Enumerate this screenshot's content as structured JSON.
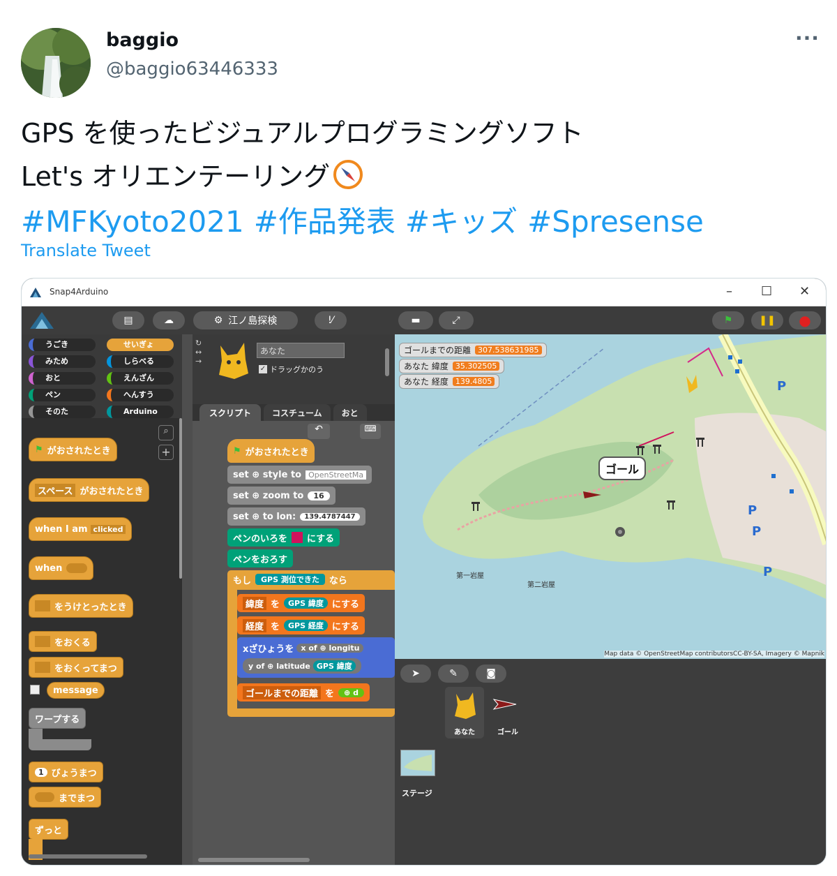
{
  "tweet": {
    "display_name": "baggio",
    "handle": "@baggio63446333",
    "more": "···",
    "line1": "GPS を使ったビジュアルプログラミングソフト",
    "line2": "Let's オリエンテーリング",
    "hashtags": [
      "#MFKyoto2021",
      "#作品発表",
      "#キッズ",
      "#Spresense"
    ],
    "translate": "Translate Tweet"
  },
  "app": {
    "window_title": "Snap4Arduino",
    "project_name": "江ノ島探検",
    "categories": [
      "うごき",
      "せいぎょ",
      "みため",
      "しらべる",
      "おと",
      "えんざん",
      "ペン",
      "へんすう",
      "そのた",
      "Arduino"
    ],
    "palette_blocks": [
      "がおされたとき",
      "スペース",
      "がおされたとき",
      "when I am",
      "clicked",
      "when",
      "をうけとったとき",
      "をおくる",
      "をおくってまつ",
      "message",
      "ワープする",
      "1",
      "びょうまつ",
      "までまつ",
      "ずっと"
    ],
    "sprite_name": "あなた",
    "draggable_label": "ドラッグかのう",
    "tabs": [
      "スクリプト",
      "コスチューム",
      "おと"
    ],
    "script_blocks": {
      "hat": "がおされたとき",
      "style": "set ⊕ style to",
      "style_val": "OpenStreetMa",
      "zoom": "set ⊕ zoom to",
      "zoom_val": "16",
      "lon": "set ⊕ to lon:",
      "lon_val": "139.4787447",
      "pen_color": "ペンのいろを",
      "pen_color_end": "にする",
      "pen_down": "ペンをおろす",
      "if": "もし",
      "if_cond": "GPS 測位できた",
      "if_end": "なら",
      "set1_var": "緯度",
      "set1_mid": "を",
      "set1_val": "GPS 緯度",
      "set1_end": "にする",
      "set2_var": "経度",
      "set2_mid": "を",
      "set2_val": "GPS 経度",
      "set2_end": "にする",
      "xy": "xざひょうを",
      "xy_val": "x of ⊕ longitu",
      "y_of": "y of ⊕ latitude",
      "y_val": "GPS 緯度",
      "goal_var": "ゴールまでの距離",
      "goal_mid": "を",
      "goal_val": "⊕ d"
    },
    "watchers": [
      {
        "label": "ゴールまでの距離",
        "value": "307.538631985"
      },
      {
        "label": "あなた 緯度",
        "value": "35.302505"
      },
      {
        "label": "あなた 経度",
        "value": "139.4805"
      }
    ],
    "map_labels": {
      "goal": "ゴール",
      "rock1": "第一岩屋",
      "rock2": "第二岩屋",
      "parking": "P"
    },
    "attribution": "Map data © OpenStreetMap contributorsCC-BY-SA, Imagery © Mapnik",
    "sprites": [
      "あなた",
      "ゴール"
    ],
    "stage_label": "ステージ"
  }
}
